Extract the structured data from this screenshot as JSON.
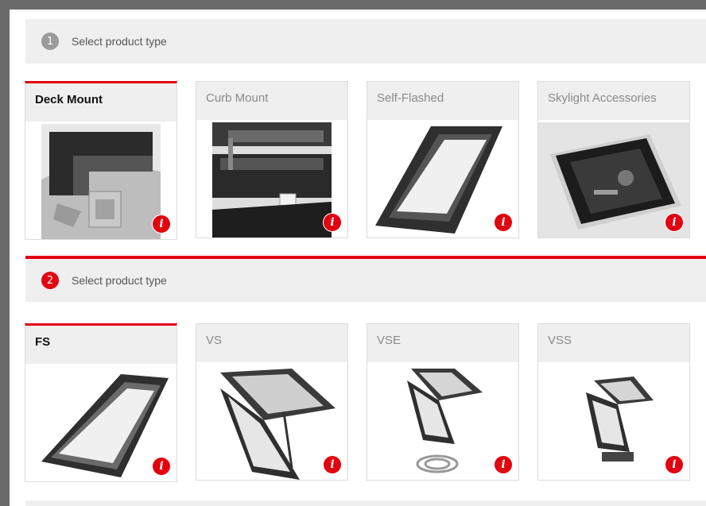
{
  "step1": {
    "number": "1",
    "label": "Select product type"
  },
  "step2": {
    "number": "2",
    "label": "Select product type"
  },
  "mount_types": [
    {
      "label": "Deck Mount",
      "selected": true,
      "icon": "deck-mount-skylight-photo"
    },
    {
      "label": "Curb Mount",
      "selected": false,
      "icon": "curb-mount-skylight-photo"
    },
    {
      "label": "Self-Flashed",
      "selected": false,
      "icon": "self-flashed-skylight-photo"
    },
    {
      "label": "Skylight Accessories",
      "selected": false,
      "icon": "control-pad-photo"
    }
  ],
  "product_types": [
    {
      "label": "FS",
      "selected": true,
      "icon": "fixed-skylight-photo"
    },
    {
      "label": "VS",
      "selected": false,
      "icon": "venting-skylight-photo"
    },
    {
      "label": "VSE",
      "selected": false,
      "icon": "electric-venting-skylight-photo"
    },
    {
      "label": "VSS",
      "selected": false,
      "icon": "solar-venting-skylight-photo"
    }
  ],
  "info_glyph": "i",
  "colors": {
    "accent": "#e3000f",
    "bar": "#efefef",
    "muted_text": "#8a8a8a"
  }
}
